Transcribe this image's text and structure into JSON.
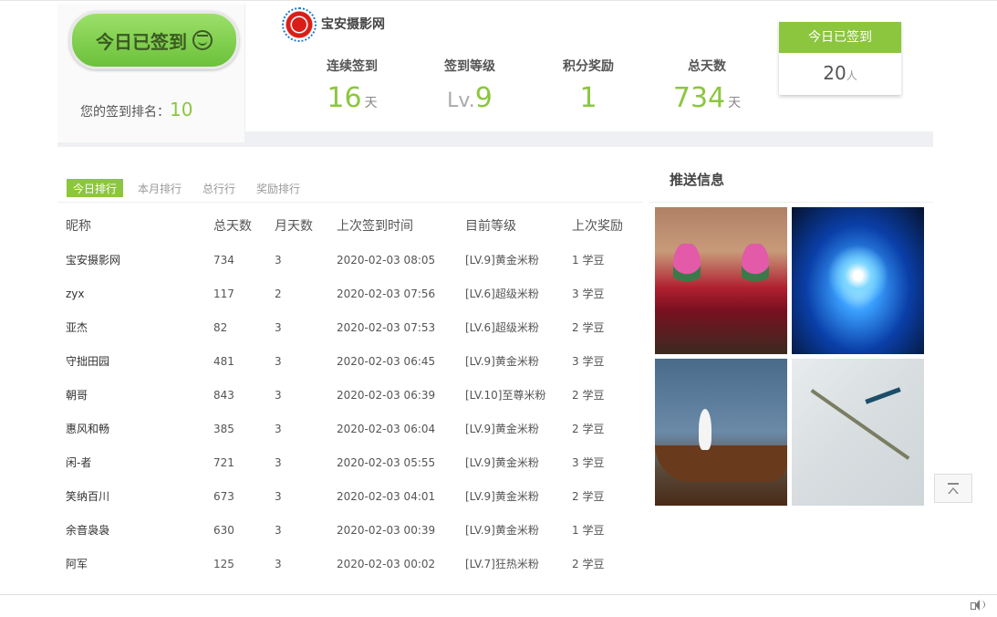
{
  "sign": {
    "button_label": "今日已签到",
    "rank_label": "您的签到排名：",
    "rank_value": "10"
  },
  "site": {
    "name": "宝安摄影网"
  },
  "stats": [
    {
      "label": "连续签到",
      "value": "16",
      "unit": "天"
    },
    {
      "label": "签到等级",
      "prefix": "Lv.",
      "value": "9",
      "unit": ""
    },
    {
      "label": "积分奖励",
      "value": "1",
      "unit": ""
    },
    {
      "label": "总天数",
      "value": "734",
      "unit": "天"
    }
  ],
  "today": {
    "title": "今日已签到",
    "count": "20",
    "unit": "人"
  },
  "tabs": [
    "今日排行",
    "本月排行",
    "总行行",
    "奖励排行"
  ],
  "table": {
    "headers": [
      "昵称",
      "总天数",
      "月天数",
      "上次签到时间",
      "目前等级",
      "上次奖励"
    ],
    "rows": [
      [
        "宝安摄影网",
        "734",
        "3",
        "2020-02-03 08:05",
        "[LV.9]黄金米粉",
        "1 学豆"
      ],
      [
        "zyx",
        "117",
        "2",
        "2020-02-03 07:56",
        "[LV.6]超级米粉",
        "3 学豆"
      ],
      [
        "亚杰",
        "82",
        "3",
        "2020-02-03 07:53",
        "[LV.6]超级米粉",
        "2 学豆"
      ],
      [
        "守拙田园",
        "481",
        "3",
        "2020-02-03 06:45",
        "[LV.9]黄金米粉",
        "3 学豆"
      ],
      [
        "朝哥",
        "843",
        "3",
        "2020-02-03 06:39",
        "[LV.10]至尊米粉",
        "2 学豆"
      ],
      [
        "惠风和畅",
        "385",
        "3",
        "2020-02-03 06:04",
        "[LV.9]黄金米粉",
        "2 学豆"
      ],
      [
        "闲-者",
        "721",
        "3",
        "2020-02-03 05:55",
        "[LV.9]黄金米粉",
        "3 学豆"
      ],
      [
        "笑纳百川",
        "673",
        "3",
        "2020-02-03 04:01",
        "[LV.9]黄金米粉",
        "2 学豆"
      ],
      [
        "余音袅袅",
        "630",
        "3",
        "2020-02-03 00:39",
        "[LV.9]黄金米粉",
        "1 学豆"
      ],
      [
        "阿军",
        "125",
        "3",
        "2020-02-03 00:02",
        "[LV.7]狂热米粉",
        "2 学豆"
      ]
    ]
  },
  "push": {
    "title": "推送信息"
  },
  "colors": {
    "accent": "#8cc63f",
    "panel": "#fafafa"
  },
  "icons": [
    "smile-icon",
    "site-logo",
    "back-to-top-icon",
    "speaker-icon"
  ]
}
